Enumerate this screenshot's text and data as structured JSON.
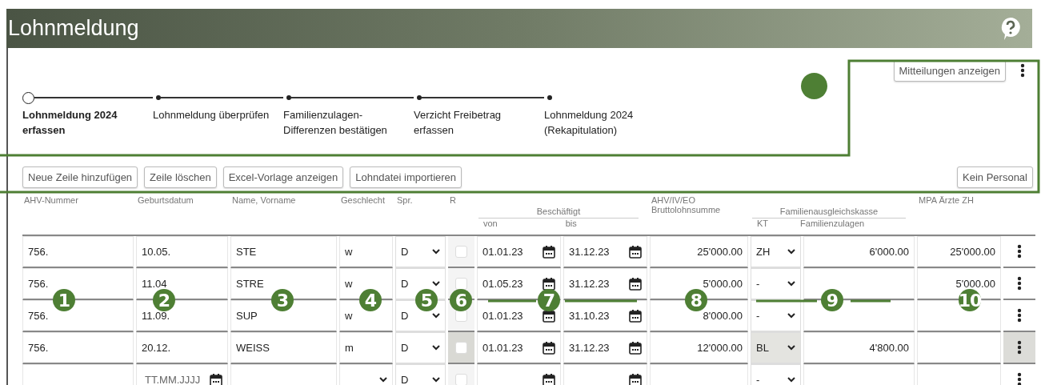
{
  "header": {
    "title": "Lohnmeldung"
  },
  "steps": [
    {
      "label": "Lohnmeldung 2024 erfassen",
      "selected": true
    },
    {
      "label": "Lohnmeldung überprüfen",
      "selected": false
    },
    {
      "label": "Familienzulagen-Differenzen bestätigen",
      "selected": false
    },
    {
      "label": "Verzicht Freibetrag erfassen",
      "selected": false
    },
    {
      "label": "Lohnmeldung 2024 (Rekapitulation)",
      "selected": false
    }
  ],
  "top_button": "Mitteilungen anzeigen",
  "toolbar": [
    "Neue Zeile hinzufügen",
    "Zeile löschen",
    "Excel-Vorlage anzeigen",
    "Lohndatei importieren"
  ],
  "right_button": "Kein Personal",
  "table": {
    "columns": {
      "ahv": "AHV-Nummer",
      "birth": "Geburtsdatum",
      "name": "Name, Vorname",
      "sex": "Geschlecht",
      "lang": "Spr.",
      "r": "R",
      "employed": "Beschäftigt",
      "from": "von",
      "to": "bis",
      "gross_1": "AHV/IV/EO",
      "gross_2": "Bruttolohnsumme",
      "fak": "Familienausgleichskasse",
      "kt": "KT",
      "allowance": "Familienzulagen",
      "mpa": "MPA Ärzte ZH"
    },
    "rows": [
      {
        "ahv": "756.",
        "birth": "10.05.",
        "name": "STE",
        "sex": "w",
        "lang": "D",
        "r": false,
        "from": "01.01.23",
        "to": "31.12.23",
        "gross": "25'000.00",
        "kt": "ZH",
        "allowance": "6'000.00",
        "mpa": "25'000.00",
        "selected": false
      },
      {
        "ahv": "756.",
        "birth": "11.04",
        "name": "STRE",
        "sex": "w",
        "lang": "D",
        "r": false,
        "from": "01.05.23",
        "to": "31.12.23",
        "gross": "5'000.00",
        "kt": "-",
        "allowance": "",
        "mpa": "5'000.00",
        "selected": false
      },
      {
        "ahv": "756.",
        "birth": "11.09.",
        "name": "SUP",
        "sex": "w",
        "lang": "D",
        "r": false,
        "from": "01.01.23",
        "to": "31.10.23",
        "gross": "8'000.00",
        "kt": "-",
        "allowance": "",
        "mpa": "",
        "selected": false
      },
      {
        "ahv": "756.",
        "birth": "20.12.",
        "name": "WEISS",
        "sex": "m",
        "lang": "D",
        "r": false,
        "from": "01.01.23",
        "to": "31.12.23",
        "gross": "12'000.00",
        "kt": "BL",
        "allowance": "4'800.00",
        "mpa": "",
        "selected": true
      },
      {
        "ahv": "",
        "birth": "",
        "birth_placeholder": "TT.MM.JJJJ",
        "name": "",
        "sex": "",
        "lang": "D",
        "r": false,
        "from": "",
        "to": "",
        "gross": "",
        "kt": "-",
        "allowance": "",
        "mpa": "",
        "selected": false
      }
    ]
  },
  "callouts": [
    "1",
    "2",
    "3",
    "4",
    "5",
    "6",
    "7",
    "8",
    "9",
    "10"
  ]
}
